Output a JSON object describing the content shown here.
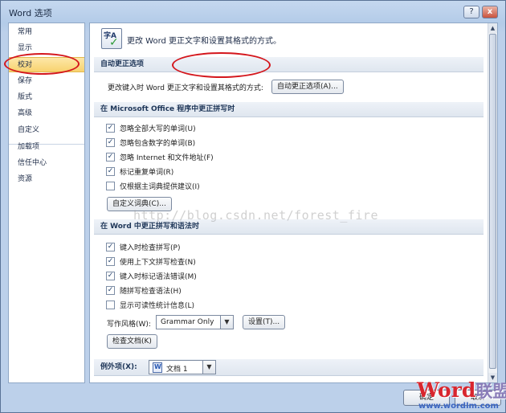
{
  "window": {
    "title": "Word 选项",
    "help_icon": "?",
    "close_icon": "x"
  },
  "nav": {
    "items": [
      {
        "label": "常用"
      },
      {
        "label": "显示"
      },
      {
        "label": "校对"
      },
      {
        "label": "保存"
      },
      {
        "label": "版式"
      },
      {
        "label": "高级"
      },
      {
        "label": "自定义"
      },
      {
        "label": "加载项"
      },
      {
        "label": "信任中心"
      },
      {
        "label": "资源"
      }
    ],
    "selected": "校对"
  },
  "header": {
    "icon": "proofing-icon",
    "icon_glyph": "字A",
    "text": "更改 Word 更正文字和设置其格式的方式。"
  },
  "autocorrect": {
    "section_title": "自动更正选项",
    "description": "更改键入时 Word 更正文字和设置其格式的方式:",
    "button_label": "自动更正选项(A)..."
  },
  "office": {
    "section_title": "在 Microsoft Office 程序中更正拼写时",
    "options": [
      {
        "label": "忽略全部大写的单词(U)",
        "checked": true
      },
      {
        "label": "忽略包含数字的单词(B)",
        "checked": true
      },
      {
        "label": "忽略 Internet 和文件地址(F)",
        "checked": true
      },
      {
        "label": "标记重复单词(R)",
        "checked": true
      },
      {
        "label": "仅根据主词典提供建议(I)",
        "checked": false
      }
    ],
    "dict_button": "自定义词典(C)..."
  },
  "word": {
    "section_title": "在 Word 中更正拼写和语法时",
    "options": [
      {
        "label": "键入时检查拼写(P)",
        "checked": true
      },
      {
        "label": "使用上下文拼写检查(N)",
        "checked": true
      },
      {
        "label": "键入时标记语法错误(M)",
        "checked": true
      },
      {
        "label": "随拼写检查语法(H)",
        "checked": true
      },
      {
        "label": "显示可读性统计信息(L)",
        "checked": false
      }
    ],
    "style_label": "写作风格(W):",
    "style_value": "Grammar Only",
    "settings_button": "设置(T)...",
    "recheck_button": "检查文档(K)"
  },
  "exceptions": {
    "label": "例外项(X):",
    "document": "文档 1"
  },
  "watermark": "http://blog.csdn.net/forest_fire",
  "footer": {
    "ok": "确定",
    "cancel": "取消"
  },
  "logo": {
    "word": "Word",
    "cn": "联盟",
    "url": "www.wordlm.com"
  },
  "colors": {
    "accent_red": "#d4161c",
    "selected_nav": "#f8d26f"
  }
}
